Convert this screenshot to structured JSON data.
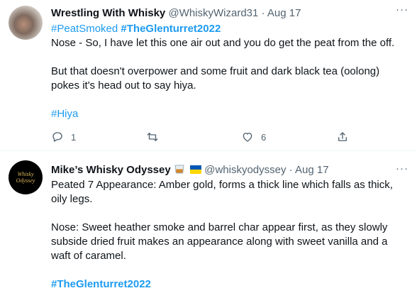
{
  "tweets": [
    {
      "name": "Wrestling With Whisky",
      "handle": "@WhiskyWizard31",
      "sep": "·",
      "date": "Aug 17",
      "more": "···",
      "hashtag_a": "#PeatSmoked",
      "hashtag_b": "#TheGlenturret2022",
      "line1": "Nose - So, I have let this one air out and you do get the peat from the off.",
      "line2": "But that doesn't overpower and some fruit and dark black tea (oolong)",
      "line3": "pokes it's head out to say hiya.",
      "hashtag_c": "#Hiya",
      "reply_count": "1",
      "like_count": "6"
    },
    {
      "name": "Mike’s Whisky Odyssey",
      "name_emoji": "tumbler-glass-icon",
      "name_flag": "ukraine-flag-icon",
      "handle": "@whiskyodyssey",
      "sep": "·",
      "date": "Aug 17",
      "more": "···",
      "avatar_text_1": "Whisky",
      "avatar_text_2": "Odyssey",
      "line1": "Peated 7 Appearance: Amber gold, forms a thick line which falls as thick,",
      "line2": "oily legs.",
      "line3": "Nose: Sweet heather smoke and barrel char appear first, as they slowly",
      "line4": "subside dried fruit makes an appearance along with sweet vanilla and a",
      "line5": "waft of caramel.",
      "hashtag": "#TheGlenturret2022"
    }
  ],
  "colors": {
    "link": "#1d9bf0",
    "muted": "#536471",
    "text": "#0f1419"
  }
}
